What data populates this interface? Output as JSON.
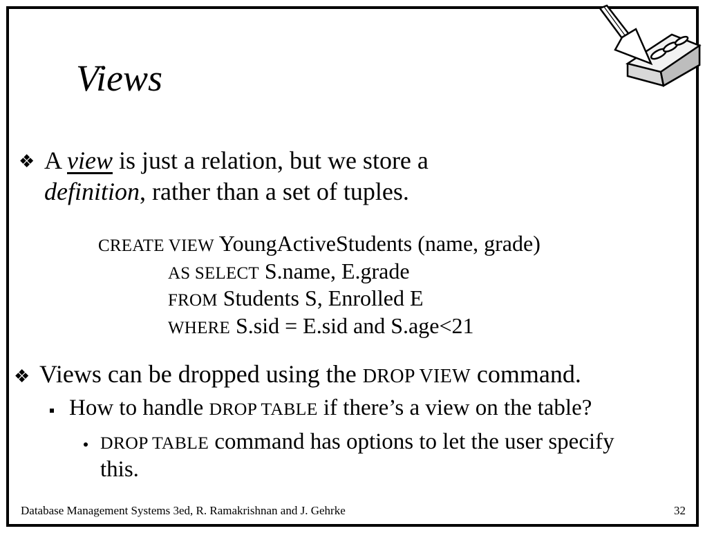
{
  "slide": {
    "title": "Views",
    "bullet1": {
      "prefix": "A ",
      "emphasis": "view",
      "rest": " is just a relation, but we store a",
      "line2_emphasis": "definition",
      "line2_rest": ", rather than a set of tuples."
    },
    "sql": {
      "line1_keyword": "CREATE  VIEW",
      "line1_rest": "  YoungActiveStudents (name, grade)",
      "line2_keyword": "AS  SELECT",
      "line2_rest": "  S.name, E.grade",
      "line3_keyword": "FROM",
      "line3_rest": "  Students S, Enrolled E",
      "line4_keyword": "WHERE",
      "line4_rest": "  S.sid = E.sid and S.age<21"
    },
    "bullet2": {
      "prefix": "Views can be dropped using the ",
      "keyword": "DROP VIEW",
      "rest": " command."
    },
    "sub_bullet": {
      "prefix": "How to handle ",
      "keyword": "DROP TABLE",
      "rest": " if there’s a view on the table?"
    },
    "sub_sub_bullet": {
      "keyword": "DROP TABLE",
      "rest": " command has options to let the user specify",
      "line2": "this."
    },
    "footer": "Database Management Systems 3ed,  R. Ramakrishnan and J. Gehrke",
    "page_number": "32",
    "bullet_glyph": "❖",
    "logo_icon": "trowel-and-brick-icon"
  }
}
